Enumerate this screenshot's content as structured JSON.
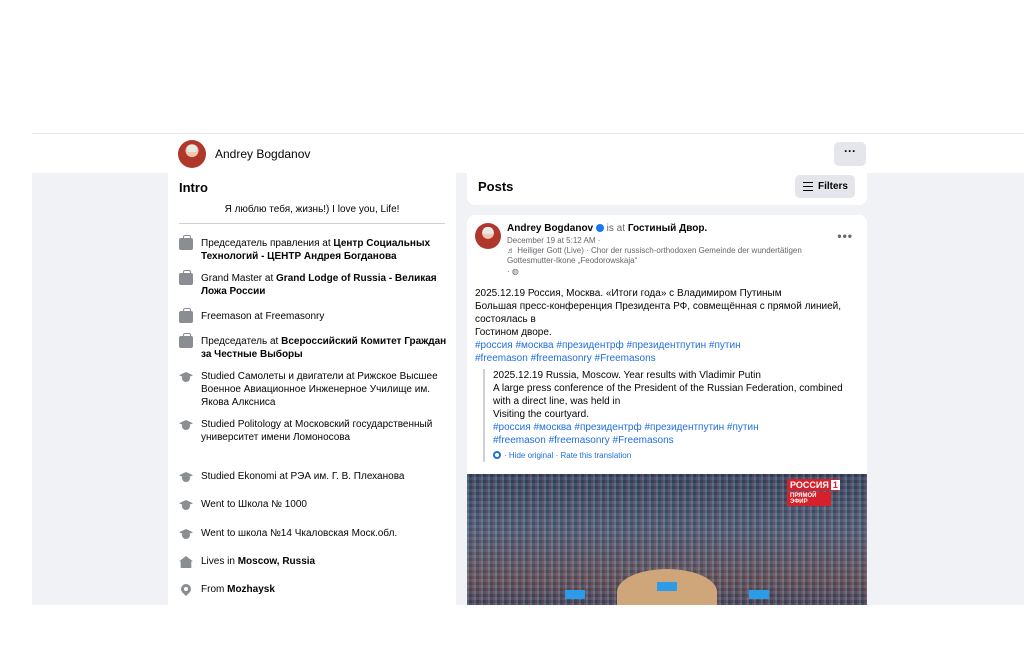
{
  "topbar": {
    "name": "Andrey Bogdanov",
    "more": "···"
  },
  "intro": {
    "title": "Intro",
    "bio": "Я люблю тебя, жизнь!) I love you, Life!",
    "items": [
      {
        "icon": "briefcase-icon",
        "pre": "Председатель правления at ",
        "bold": "Центр Социальных Технологий - ЦЕНТР Андрея Богданова"
      },
      {
        "icon": "briefcase-icon",
        "pre": "Grand Master at ",
        "bold": "Grand Lodge of Russia - Великая Ложа России"
      },
      {
        "icon": "briefcase-icon",
        "pre": "Freemason at Freemasonry",
        "bold": ""
      },
      {
        "icon": "briefcase-icon",
        "pre": "Председатель at ",
        "bold": "Всероссийский Комитет Граждан за Честные Выборы"
      },
      {
        "icon": "graduation-cap-icon",
        "pre": "Studied Самолеты и двигатели at Рижское Высшее Военное Авиационное Инженерное Училище им. Якова Алксниса",
        "bold": ""
      },
      {
        "icon": "graduation-cap-icon",
        "pre": "Studied Politology at Московский государственный университет имени Ломоносова",
        "bold": ""
      },
      {
        "icon": "graduation-cap-icon",
        "pre": "Studied Ekonomi at РЭА им. Г. В. Плеханова",
        "bold": ""
      },
      {
        "icon": "graduation-cap-icon",
        "pre": "Went to Школа № 1000",
        "bold": ""
      },
      {
        "icon": "graduation-cap-icon",
        "pre": "Went to школа №14 Чкаловская Моск.обл.",
        "bold": ""
      },
      {
        "icon": "home-icon",
        "pre": "Lives in ",
        "bold": "Moscow, Russia"
      },
      {
        "icon": "location-pin-icon",
        "pre": "From ",
        "bold": "Mozhaysk"
      }
    ]
  },
  "posts": {
    "title": "Posts",
    "filters": "Filters",
    "post": {
      "author": "Andrey Bogdanov",
      "is_at": " is at ",
      "place": "Гостиный Двор.",
      "date": "December 19 at 5:12 AM ·",
      "music": "♬ Heiliger Gott (Live) · Chor der russisch-orthodoxen Gemeinde der wundertätigen Gottesmutter-Ikone „Feodorowskaja“",
      "audience": "· ◍",
      "body_lines": [
        "2025.12.19 Россия, Москва. «Итоги года» с Владимиром Путиным",
        "Большая пресс-конференция Президента РФ, совмещённая с прямой линией,",
        "состоялась в",
        "Гостином дворе."
      ],
      "tags_lines": [
        "#россия #москва #президентрф #президентпутин #путин",
        "#freemason #freemasonry #Freemasons"
      ],
      "translation_lines": [
        "2025.12.19 Russia, Moscow. Year results with Vladimir Putin",
        "A large press conference of the President of the Russian Federation, combined",
        "with a direct line, was held in",
        "Visiting the courtyard."
      ],
      "translation_tags_lines": [
        "#россия #москва #президентрф #президентпутин #путин",
        "#freemason #freemasonry #Freemasons"
      ],
      "hide_original": "· Hide original",
      "rate_translation": " · Rate this translation",
      "tv_logo": "РОССИЯ",
      "tv_logo_num": "1",
      "tv_live": "ПРЯМОЙ ЭФИР"
    }
  }
}
